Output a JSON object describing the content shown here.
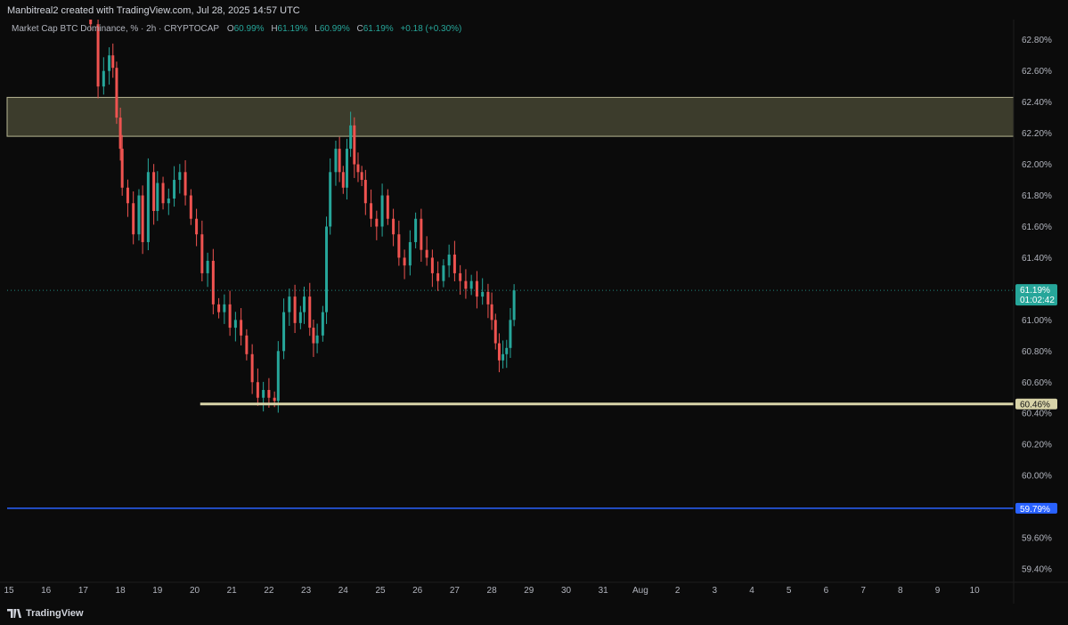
{
  "header": {
    "attribution": "Manbitreal2 created with TradingView.com, Jul 28, 2025 14:57 UTC",
    "symbol": "Market Cap BTC Dominance, % · 2h · CRYPTOCAP",
    "ohlc": [
      {
        "k": "O",
        "v": "60.99%"
      },
      {
        "k": "H",
        "v": "61.19%"
      },
      {
        "k": "L",
        "v": "60.99%"
      },
      {
        "k": "C",
        "v": "61.19%"
      }
    ],
    "change": "+0.18 (+0.30%)"
  },
  "footer": {
    "brand": "TradingView"
  },
  "chart_data": {
    "type": "candlestick",
    "ylim": [
      59.32,
      62.93
    ],
    "xlim": [
      14.9,
      10.8
    ],
    "y_ticks": [
      "62.80%",
      "62.60%",
      "62.40%",
      "62.20%",
      "62.00%",
      "61.80%",
      "61.60%",
      "61.40%",
      "61.00%",
      "60.80%",
      "60.60%",
      "60.40%",
      "60.20%",
      "60.00%",
      "59.60%",
      "59.40%"
    ],
    "y_tick_values": [
      62.8,
      62.6,
      62.4,
      62.2,
      62.0,
      61.8,
      61.6,
      61.4,
      61.0,
      60.8,
      60.6,
      60.4,
      60.2,
      60.0,
      59.6,
      59.4
    ],
    "x_ticks": [
      "15",
      "16",
      "17",
      "18",
      "19",
      "20",
      "21",
      "22",
      "23",
      "24",
      "25",
      "26",
      "27",
      "28",
      "29",
      "30",
      "31",
      "Aug",
      "2",
      "3",
      "4",
      "5",
      "6",
      "7",
      "8",
      "9",
      "10"
    ],
    "current_price": {
      "value": 61.19,
      "label": "61.19%",
      "countdown": "01:02:42",
      "color": "#26a69a"
    },
    "levels": [
      {
        "value": 60.46,
        "label": "60.46%",
        "color": "#d8d3a8",
        "from_x": 20.15
      },
      {
        "value": 59.79,
        "label": "59.79%",
        "color": "#2962ff",
        "from_x": 14.9
      }
    ],
    "zone": {
      "y_low": 62.18,
      "y_high": 62.43,
      "color": "#3c3c2c",
      "border": "#b9b894"
    },
    "up_color": "#26a69a",
    "down_color": "#ef5350",
    "candles": [
      {
        "x": 17.2,
        "close": 62.9
      },
      {
        "x": 17.4,
        "close": 62.5
      },
      {
        "x": 17.55,
        "close": 62.6
      },
      {
        "x": 17.7,
        "close": 62.7
      },
      {
        "x": 17.8,
        "close": 62.62
      },
      {
        "x": 17.9,
        "close": 62.3
      },
      {
        "x": 18.0,
        "close": 62.1
      },
      {
        "x": 18.05,
        "close": 61.85
      },
      {
        "x": 18.2,
        "close": 61.75
      },
      {
        "x": 18.35,
        "close": 61.55
      },
      {
        "x": 18.5,
        "close": 61.8
      },
      {
        "x": 18.6,
        "close": 61.5
      },
      {
        "x": 18.75,
        "close": 61.95
      },
      {
        "x": 18.9,
        "close": 61.7
      },
      {
        "x": 19.0,
        "close": 61.88
      },
      {
        "x": 19.15,
        "close": 61.75
      },
      {
        "x": 19.3,
        "close": 61.78
      },
      {
        "x": 19.45,
        "close": 61.9
      },
      {
        "x": 19.6,
        "close": 61.95
      },
      {
        "x": 19.75,
        "close": 61.8
      },
      {
        "x": 19.9,
        "close": 61.65
      },
      {
        "x": 20.05,
        "close": 61.55
      },
      {
        "x": 20.2,
        "close": 61.3
      },
      {
        "x": 20.35,
        "close": 61.38
      },
      {
        "x": 20.5,
        "close": 61.1
      },
      {
        "x": 20.65,
        "close": 61.05
      },
      {
        "x": 20.8,
        "close": 61.1
      },
      {
        "x": 20.95,
        "close": 60.95
      },
      {
        "x": 21.1,
        "close": 61.0
      },
      {
        "x": 21.25,
        "close": 60.9
      },
      {
        "x": 21.4,
        "close": 60.78
      },
      {
        "x": 21.55,
        "close": 60.6
      },
      {
        "x": 21.7,
        "close": 60.5
      },
      {
        "x": 21.85,
        "close": 60.55
      },
      {
        "x": 22.0,
        "close": 60.5
      },
      {
        "x": 22.15,
        "close": 60.48
      },
      {
        "x": 22.25,
        "close": 60.8
      },
      {
        "x": 22.4,
        "close": 61.05
      },
      {
        "x": 22.55,
        "close": 61.15
      },
      {
        "x": 22.7,
        "close": 60.98
      },
      {
        "x": 22.85,
        "close": 61.05
      },
      {
        "x": 22.95,
        "close": 61.15
      },
      {
        "x": 23.1,
        "close": 60.95
      },
      {
        "x": 23.2,
        "close": 60.85
      },
      {
        "x": 23.3,
        "close": 60.9
      },
      {
        "x": 23.45,
        "close": 61.05
      },
      {
        "x": 23.55,
        "close": 61.6
      },
      {
        "x": 23.65,
        "close": 61.95
      },
      {
        "x": 23.8,
        "close": 62.1
      },
      {
        "x": 23.9,
        "close": 61.95
      },
      {
        "x": 24.0,
        "close": 61.85
      },
      {
        "x": 24.1,
        "close": 62.1
      },
      {
        "x": 24.2,
        "close": 62.25
      },
      {
        "x": 24.3,
        "close": 62.0
      },
      {
        "x": 24.4,
        "close": 61.95
      },
      {
        "x": 24.5,
        "close": 61.9
      },
      {
        "x": 24.6,
        "close": 61.75
      },
      {
        "x": 24.75,
        "close": 61.65
      },
      {
        "x": 24.9,
        "close": 61.6
      },
      {
        "x": 25.05,
        "close": 61.8
      },
      {
        "x": 25.2,
        "close": 61.65
      },
      {
        "x": 25.35,
        "close": 61.55
      },
      {
        "x": 25.5,
        "close": 61.4
      },
      {
        "x": 25.65,
        "close": 61.35
      },
      {
        "x": 25.8,
        "close": 61.5
      },
      {
        "x": 25.95,
        "close": 61.65
      },
      {
        "x": 26.1,
        "close": 61.45
      },
      {
        "x": 26.25,
        "close": 61.4
      },
      {
        "x": 26.4,
        "close": 61.3
      },
      {
        "x": 26.55,
        "close": 61.25
      },
      {
        "x": 26.7,
        "close": 61.35
      },
      {
        "x": 26.85,
        "close": 61.42
      },
      {
        "x": 27.0,
        "close": 61.3
      },
      {
        "x": 27.15,
        "close": 61.25
      },
      {
        "x": 27.3,
        "close": 61.2
      },
      {
        "x": 27.45,
        "close": 61.25
      },
      {
        "x": 27.6,
        "close": 61.15
      },
      {
        "x": 27.75,
        "close": 61.18
      },
      {
        "x": 27.9,
        "close": 61.1
      },
      {
        "x": 28.0,
        "close": 61.0
      },
      {
        "x": 28.1,
        "close": 60.85
      },
      {
        "x": 28.2,
        "close": 60.74
      },
      {
        "x": 28.3,
        "close": 60.78
      },
      {
        "x": 28.4,
        "close": 60.82
      },
      {
        "x": 28.5,
        "close": 61.0
      },
      {
        "x": 28.6,
        "close": 61.19
      }
    ]
  }
}
